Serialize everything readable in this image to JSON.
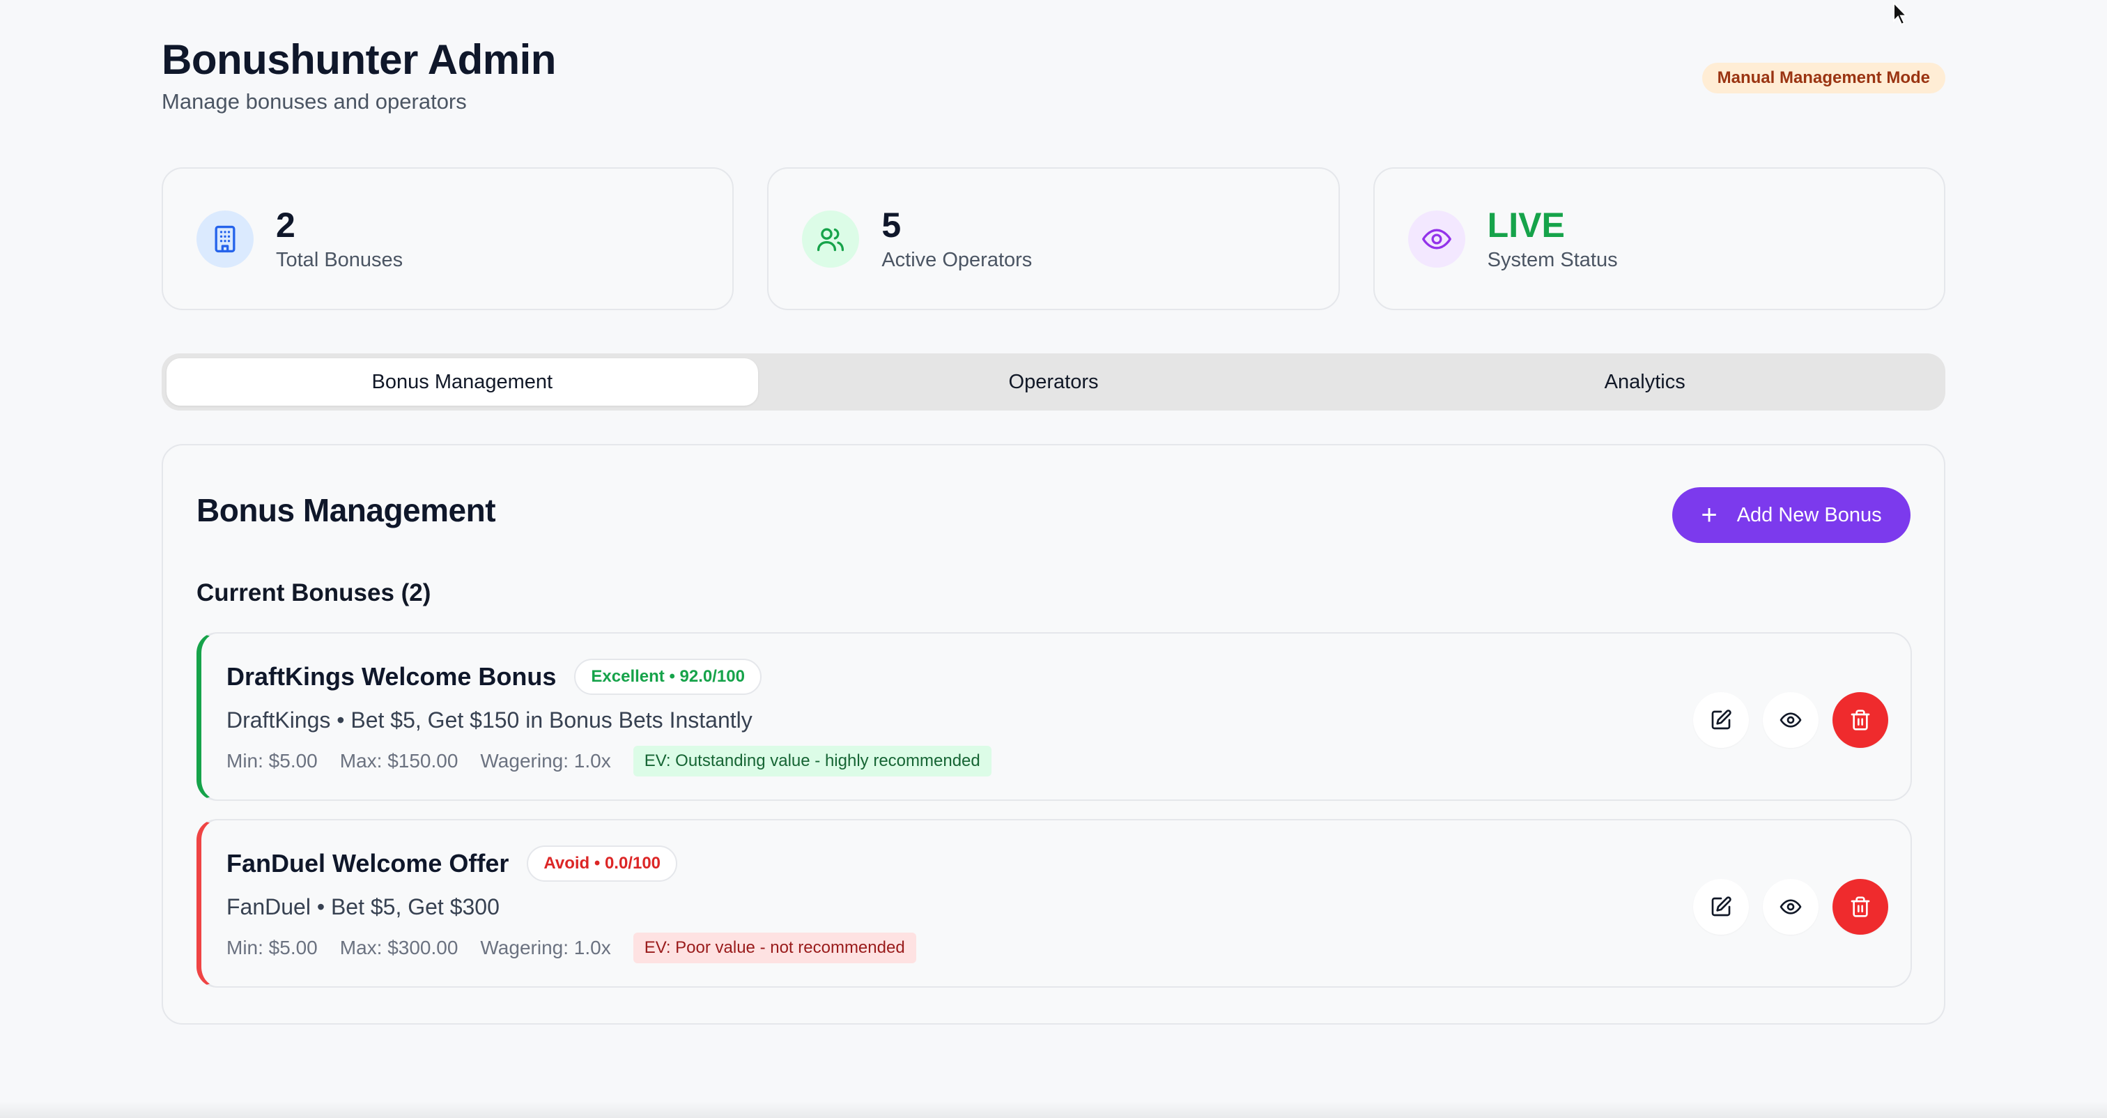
{
  "header": {
    "title": "Bonushunter Admin",
    "subtitle": "Manage bonuses and operators",
    "mode_badge": "Manual Management Mode"
  },
  "stats": [
    {
      "value": "2",
      "label": "Total Bonuses",
      "icon": "building-icon",
      "icon_color": "#2563eb",
      "icon_bg": "#dbeafe"
    },
    {
      "value": "5",
      "label": "Active Operators",
      "icon": "users-icon",
      "icon_color": "#16a34a",
      "icon_bg": "#dcfce7"
    },
    {
      "value": "LIVE",
      "label": "System Status",
      "icon": "eye-icon",
      "icon_color": "#9333ea",
      "icon_bg": "#f3e8ff"
    }
  ],
  "tabs": [
    {
      "label": "Bonus Management",
      "active": true
    },
    {
      "label": "Operators",
      "active": false
    },
    {
      "label": "Analytics",
      "active": false
    }
  ],
  "panel": {
    "title": "Bonus Management",
    "add_button": "Add New Bonus",
    "section_title": "Current Bonuses (2)"
  },
  "bonuses": [
    {
      "name": "DraftKings Welcome Bonus",
      "score": "Excellent • 92.0/100",
      "description": "DraftKings • Bet $5, Get $150 in Bonus Bets Instantly",
      "min": "Min: $5.00",
      "max": "Max: $150.00",
      "wagering": "Wagering: 1.0x",
      "ev": "EV: Outstanding value - highly recommended",
      "rating": "good"
    },
    {
      "name": "FanDuel Welcome Offer",
      "score": "Avoid • 0.0/100",
      "description": "FanDuel • Bet $5, Get $300",
      "min": "Min: $5.00",
      "max": "Max: $300.00",
      "wagering": "Wagering: 1.0x",
      "ev": "EV: Poor value - not recommended",
      "rating": "poor"
    }
  ],
  "colors": {
    "accent": "#7c3aed",
    "live": "#16a34a",
    "danger": "#ef2b2d"
  }
}
